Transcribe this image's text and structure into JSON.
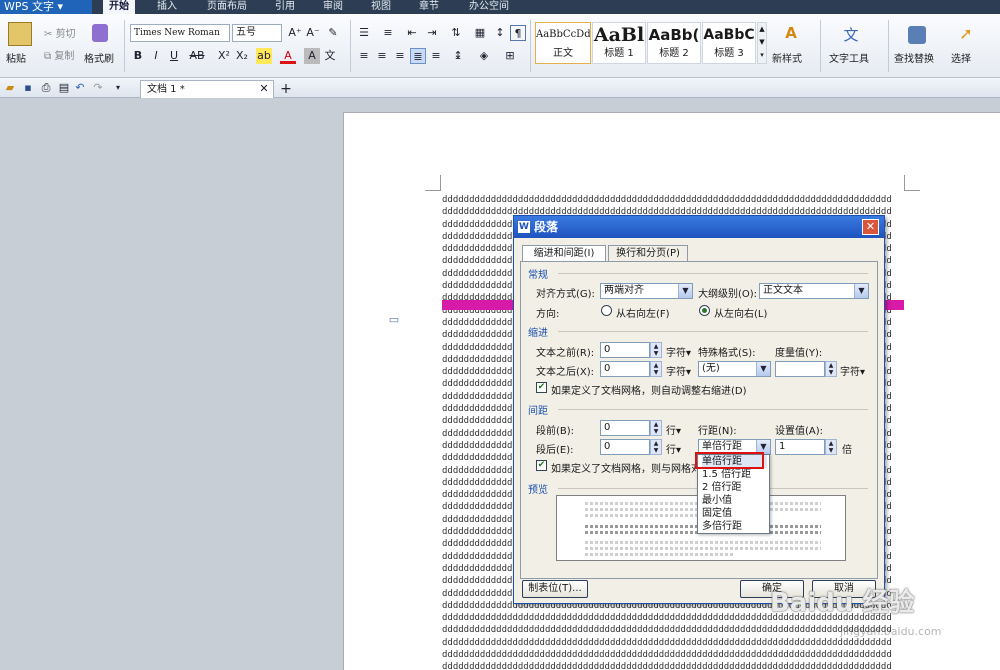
{
  "app": {
    "title": "WPS 文字"
  },
  "menu": [
    "开始",
    "插入",
    "页面布局",
    "引用",
    "审阅",
    "视图",
    "章节",
    "办公空间"
  ],
  "ribbon": {
    "paste": "粘贴",
    "cut": "剪切",
    "copy": "复制",
    "format_painter": "格式刷",
    "font_name": "Times New Roman",
    "font_size": "五号",
    "styles": [
      {
        "sample": "AaBbCcDd",
        "name": "正文"
      },
      {
        "sample": "AaBl",
        "name": "标题 1"
      },
      {
        "sample": "AaBb(",
        "name": "标题 2"
      },
      {
        "sample": "AaBbC",
        "name": "标题 3"
      }
    ],
    "new_style": "新样式",
    "text_tools": "文字工具",
    "find_replace": "查找替换",
    "select": "选择"
  },
  "tabs": {
    "doc_tab": "文档 1 *"
  },
  "document": {
    "line_text": "ddddddddddddddddddddddddddddddddddddddddddddddddddddddddddddddddddddddddddddddddddd"
  },
  "dialog": {
    "title": "段落",
    "tab_indent": "缩进和间距(I)",
    "tab_break": "换行和分页(P)",
    "general": "常规",
    "align_label": "对齐方式(G):",
    "align_value": "两端对齐",
    "outline_label": "大纲级别(O):",
    "outline_value": "正文文本",
    "direction_label": "方向:",
    "rtl": "从右向左(F)",
    "ltr": "从左向右(L)",
    "indent": "缩进",
    "before_text_label": "文本之前(R):",
    "before_text_value": "0",
    "after_text_label": "文本之后(X):",
    "after_text_value": "0",
    "unit_chars": "字符▾",
    "special_label": "特殊格式(S):",
    "special_value": "(无)",
    "measure_label": "度量值(Y):",
    "grid_indent_check": "如果定义了文档网格，则自动调整右缩进(D)",
    "spacing": "间距",
    "before_label": "段前(B):",
    "before_value": "0",
    "after_label": "段后(E):",
    "after_value": "0",
    "unit_lines": "行▾",
    "line_spacing_label": "行距(N):",
    "line_spacing_value": "单倍行距",
    "set_value_label": "设置值(A):",
    "set_value": "1",
    "unit_times": "倍",
    "grid_align_check": "如果定义了文档网格，则与网格对",
    "preview": "预览",
    "tab_stops": "制表位(T)...",
    "ok": "确定",
    "cancel": "取消"
  },
  "line_spacing_options": [
    "单倍行距",
    "1.5 倍行距",
    "2 倍行距",
    "最小值",
    "固定值",
    "多倍行距"
  ],
  "watermark": {
    "brand": "Baidu 经验",
    "url": "jingyan.baidu.com"
  },
  "colors": {
    "highlight_bar": "#d71aa8",
    "selection_box": "#dd1111",
    "title_bar": "#1f53bf"
  }
}
